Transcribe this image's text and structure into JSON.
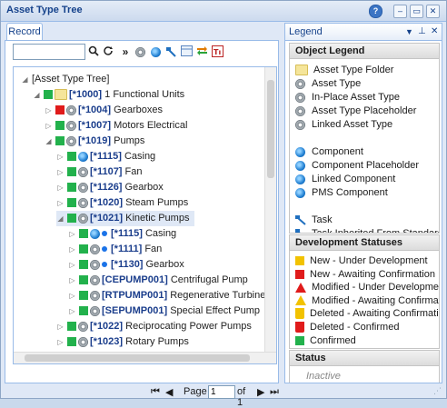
{
  "window": {
    "title": "Asset Type Tree"
  },
  "left": {
    "tab_label": "Record",
    "search_value": "",
    "tree": [
      {
        "text": "[Asset Type Tree]",
        "code": "",
        "level": 0,
        "expanded": "open",
        "icons": []
      },
      {
        "code": "[*1000]",
        "text": "1 Functional Units",
        "level": 1,
        "expanded": "open",
        "icons": [
          "green",
          "folder"
        ]
      },
      {
        "code": "[*1004]",
        "text": "Gearboxes",
        "level": 2,
        "expanded": "closed",
        "icons": [
          "red",
          "gear"
        ]
      },
      {
        "code": "[*1007]",
        "text": "Motors Electrical",
        "level": 2,
        "expanded": "closed",
        "icons": [
          "green",
          "gear"
        ]
      },
      {
        "code": "[*1019]",
        "text": "Pumps",
        "level": 2,
        "expanded": "open",
        "icons": [
          "green",
          "gear"
        ]
      },
      {
        "code": "[*1115]",
        "text": "Casing",
        "level": 3,
        "expanded": "closed",
        "icons": [
          "green",
          "comp"
        ]
      },
      {
        "code": "[*1107]",
        "text": "Fan",
        "level": 3,
        "expanded": "closed",
        "icons": [
          "green",
          "gear"
        ]
      },
      {
        "code": "[*1126]",
        "text": "Gearbox",
        "level": 3,
        "expanded": "closed",
        "icons": [
          "green",
          "gear"
        ]
      },
      {
        "code": "[*1020]",
        "text": "Steam Pumps",
        "level": 3,
        "expanded": "closed",
        "icons": [
          "green",
          "gear"
        ]
      },
      {
        "code": "[*1021]",
        "text": "Kinetic Pumps",
        "level": 3,
        "expanded": "open",
        "icons": [
          "green",
          "gear"
        ],
        "selected": true
      },
      {
        "code": "[*1115]",
        "text": "Casing",
        "level": 4,
        "expanded": "closed",
        "icons": [
          "green",
          "comp",
          "dot"
        ]
      },
      {
        "code": "[*1111]",
        "text": "Fan",
        "level": 4,
        "expanded": "closed",
        "icons": [
          "green",
          "gear",
          "dot"
        ]
      },
      {
        "code": "[*1130]",
        "text": "Gearbox",
        "level": 4,
        "expanded": "closed",
        "icons": [
          "green",
          "gear",
          "dot"
        ]
      },
      {
        "code": "[CEPUMP001]",
        "text": "Centrifugal Pump",
        "level": 4,
        "expanded": "closed",
        "icons": [
          "green",
          "gear"
        ]
      },
      {
        "code": "[RTPUMP001]",
        "text": "Regenerative Turbine Pump",
        "level": 4,
        "expanded": "closed",
        "icons": [
          "green",
          "gear"
        ]
      },
      {
        "code": "[SEPUMP001]",
        "text": "Special Effect Pump",
        "level": 4,
        "expanded": "closed",
        "icons": [
          "green",
          "gear"
        ]
      },
      {
        "code": "[*1022]",
        "text": "Reciprocating Power Pumps",
        "level": 3,
        "expanded": "closed",
        "icons": [
          "green",
          "gear"
        ]
      },
      {
        "code": "[*1023]",
        "text": "Rotary Pumps",
        "level": 3,
        "expanded": "closed",
        "icons": [
          "green",
          "gear"
        ]
      }
    ],
    "pager": {
      "page_label": "Page",
      "page_value": "1",
      "of_label": "of 1"
    }
  },
  "legend": {
    "title": "Legend",
    "object_legend": {
      "heading": "Object Legend",
      "items": [
        {
          "label": "Asset Type Folder",
          "icon": "folder-icon"
        },
        {
          "label": "Asset Type",
          "icon": "gear-icon"
        },
        {
          "label": "In-Place Asset Type",
          "icon": "gear-icon"
        },
        {
          "label": "Asset Type Placeholder",
          "icon": "gear-icon"
        },
        {
          "label": "Linked Asset Type",
          "icon": "gear-icon"
        },
        {
          "label": "Component",
          "icon": "component-icon"
        },
        {
          "label": "Component Placeholder",
          "icon": "component-icon"
        },
        {
          "label": "Linked Component",
          "icon": "component-icon"
        },
        {
          "label": "PMS Component",
          "icon": "component-icon"
        },
        {
          "label": "Task",
          "icon": "task-icon"
        },
        {
          "label": "Task Inherited From Standard T",
          "icon": "task-icon"
        }
      ]
    },
    "development_statuses": {
      "heading": "Development Statuses",
      "items": [
        {
          "label": "New - Under Development",
          "icon": "square",
          "color": "#f2c200"
        },
        {
          "label": "New - Awaiting Confirmation",
          "icon": "square",
          "color": "#e01b1b"
        },
        {
          "label": "Modified - Under Development",
          "icon": "triangle",
          "color": "#e01b1b"
        },
        {
          "label": "Modified - Awaiting Confirmatio",
          "icon": "triangle",
          "color": "#f2c200"
        },
        {
          "label": "Deleted - Awaiting Confirmation",
          "icon": "bin",
          "color": "#f2c200"
        },
        {
          "label": "Deleted - Confirmed",
          "icon": "bin",
          "color": "#e01b1b"
        },
        {
          "label": "Confirmed",
          "icon": "square",
          "color": "#22b14c"
        }
      ]
    },
    "status": {
      "heading": "Status",
      "value": "Inactive"
    }
  }
}
